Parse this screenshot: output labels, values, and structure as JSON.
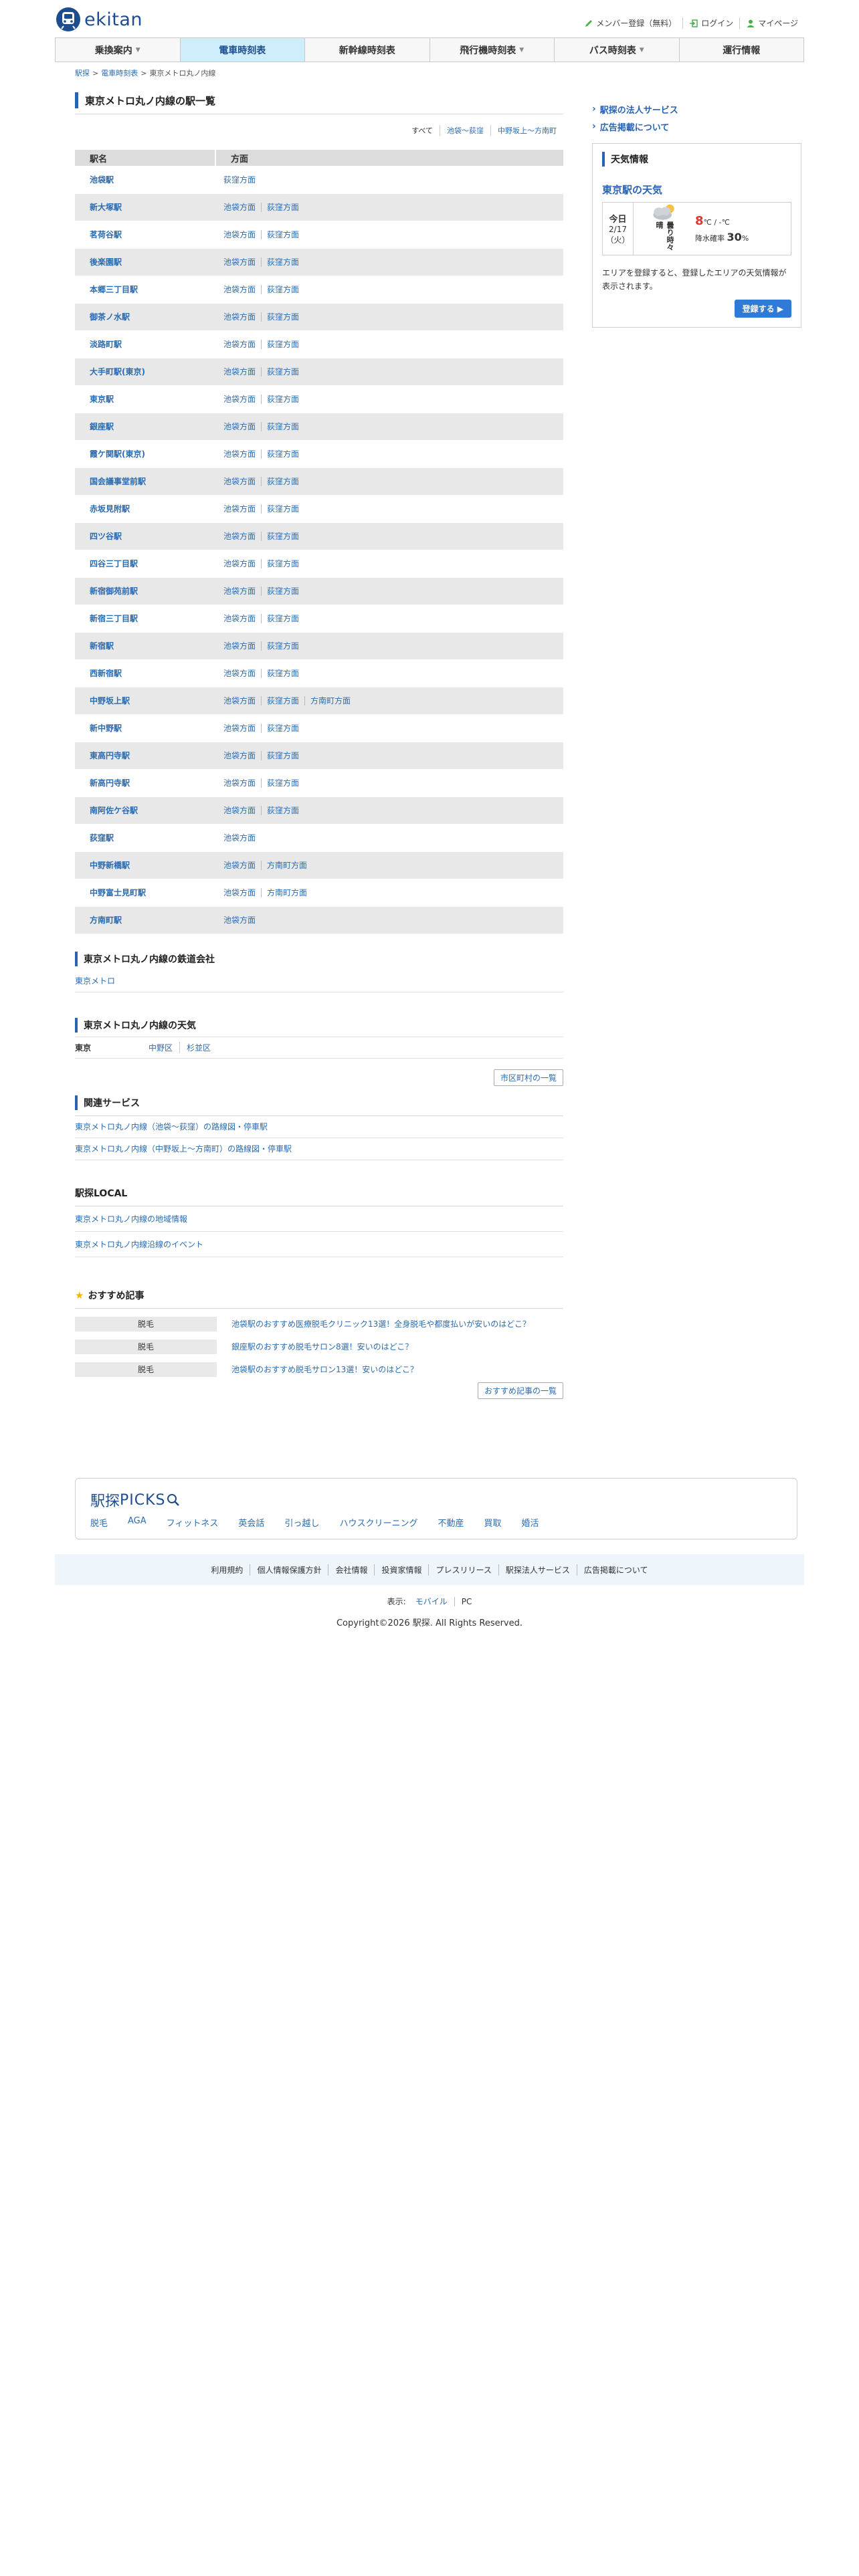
{
  "header": {
    "logo_text": "ekitan",
    "links": [
      {
        "label": "メンバー登録（無料）",
        "icon": "pencil-icon"
      },
      {
        "label": "ログイン",
        "icon": "login-icon"
      },
      {
        "label": "マイページ",
        "icon": "user-icon"
      }
    ]
  },
  "nav": [
    {
      "label": "乗換案内",
      "caret": true
    },
    {
      "label": "電車時刻表",
      "caret": false,
      "active": true
    },
    {
      "label": "新幹線時刻表",
      "caret": false
    },
    {
      "label": "飛行機時刻表",
      "caret": true
    },
    {
      "label": "バス時刻表",
      "caret": true
    },
    {
      "label": "運行情報",
      "caret": false
    }
  ],
  "breadcrumb": [
    "駅探",
    "電車時刻表",
    "東京メトロ丸ノ内線"
  ],
  "main": {
    "title": "東京メトロ丸ノ内線の駅一覧",
    "filters": [
      "すべて",
      "池袋〜荻窪",
      "中野坂上〜方南町"
    ],
    "table": {
      "headers": [
        "駅名",
        "方面"
      ],
      "rows": [
        {
          "name": "池袋駅",
          "dirs": [
            "荻窪方面"
          ]
        },
        {
          "name": "新大塚駅",
          "dirs": [
            "池袋方面",
            "荻窪方面"
          ]
        },
        {
          "name": "茗荷谷駅",
          "dirs": [
            "池袋方面",
            "荻窪方面"
          ]
        },
        {
          "name": "後楽園駅",
          "dirs": [
            "池袋方面",
            "荻窪方面"
          ]
        },
        {
          "name": "本郷三丁目駅",
          "dirs": [
            "池袋方面",
            "荻窪方面"
          ]
        },
        {
          "name": "御茶ノ水駅",
          "dirs": [
            "池袋方面",
            "荻窪方面"
          ]
        },
        {
          "name": "淡路町駅",
          "dirs": [
            "池袋方面",
            "荻窪方面"
          ]
        },
        {
          "name": "大手町駅(東京)",
          "dirs": [
            "池袋方面",
            "荻窪方面"
          ]
        },
        {
          "name": "東京駅",
          "dirs": [
            "池袋方面",
            "荻窪方面"
          ]
        },
        {
          "name": "銀座駅",
          "dirs": [
            "池袋方面",
            "荻窪方面"
          ]
        },
        {
          "name": "霞ケ関駅(東京)",
          "dirs": [
            "池袋方面",
            "荻窪方面"
          ]
        },
        {
          "name": "国会議事堂前駅",
          "dirs": [
            "池袋方面",
            "荻窪方面"
          ]
        },
        {
          "name": "赤坂見附駅",
          "dirs": [
            "池袋方面",
            "荻窪方面"
          ]
        },
        {
          "name": "四ツ谷駅",
          "dirs": [
            "池袋方面",
            "荻窪方面"
          ]
        },
        {
          "name": "四谷三丁目駅",
          "dirs": [
            "池袋方面",
            "荻窪方面"
          ]
        },
        {
          "name": "新宿御苑前駅",
          "dirs": [
            "池袋方面",
            "荻窪方面"
          ]
        },
        {
          "name": "新宿三丁目駅",
          "dirs": [
            "池袋方面",
            "荻窪方面"
          ]
        },
        {
          "name": "新宿駅",
          "dirs": [
            "池袋方面",
            "荻窪方面"
          ]
        },
        {
          "name": "西新宿駅",
          "dirs": [
            "池袋方面",
            "荻窪方面"
          ]
        },
        {
          "name": "中野坂上駅",
          "dirs": [
            "池袋方面",
            "荻窪方面",
            "方南町方面"
          ]
        },
        {
          "name": "新中野駅",
          "dirs": [
            "池袋方面",
            "荻窪方面"
          ]
        },
        {
          "name": "東高円寺駅",
          "dirs": [
            "池袋方面",
            "荻窪方面"
          ]
        },
        {
          "name": "新高円寺駅",
          "dirs": [
            "池袋方面",
            "荻窪方面"
          ]
        },
        {
          "name": "南阿佐ケ谷駅",
          "dirs": [
            "池袋方面",
            "荻窪方面"
          ]
        },
        {
          "name": "荻窪駅",
          "dirs": [
            "池袋方面"
          ]
        },
        {
          "name": "中野新橋駅",
          "dirs": [
            "池袋方面",
            "方南町方面"
          ]
        },
        {
          "name": "中野富士見町駅",
          "dirs": [
            "池袋方面",
            "方南町方面"
          ]
        },
        {
          "name": "方南町駅",
          "dirs": [
            "池袋方面"
          ]
        }
      ]
    },
    "company": {
      "title": "東京メトロ丸ノ内線の鉄道会社",
      "link": "東京メトロ"
    },
    "weather": {
      "title": "東京メトロ丸ノ内線の天気",
      "pref": "東京",
      "wards": [
        "中野区",
        "杉並区"
      ],
      "more": "市区町村の一覧"
    },
    "related": {
      "title": "関連サービス",
      "links": [
        "東京メトロ丸ノ内線（池袋〜荻窪）の路線図・停車駅",
        "東京メトロ丸ノ内線（中野坂上〜方南町）の路線図・停車駅"
      ]
    },
    "local": {
      "title": "駅探LOCAL",
      "links": [
        "東京メトロ丸ノ内線の地域情報",
        "東京メトロ丸ノ内線沿線のイベント"
      ]
    },
    "articles": {
      "title": "おすすめ記事",
      "items": [
        {
          "tag": "脱毛",
          "text": "池袋駅のおすすめ医療脱毛クリニック13選！全身脱毛や都度払いが安いのはどこ？"
        },
        {
          "tag": "脱毛",
          "text": "銀座駅のおすすめ脱毛サロン8選！安いのはどこ？"
        },
        {
          "tag": "脱毛",
          "text": "池袋駅のおすすめ脱毛サロン13選！安いのはどこ？"
        }
      ],
      "more": "おすすめ記事の一覧"
    }
  },
  "side": {
    "links": [
      "駅探の法人サービス",
      "広告掲載について"
    ],
    "weather": {
      "title": "天気情報",
      "station": "東京駅の天気",
      "day": "今日",
      "date": "2/17",
      "weekday": "（火）",
      "condition": "曇り時々晴",
      "hi": "8",
      "hi_unit": "℃",
      "lo": "-",
      "lo_unit": "℃",
      "rain_label": "降水確率",
      "rain": "30",
      "rain_unit": "%",
      "note": "エリアを登録すると、登録したエリアの天気情報が表示されます。",
      "button": "登録する ▶"
    }
  },
  "picks": {
    "title": "駅探",
    "title2": "PICKS",
    "items": [
      "脱毛",
      "AGA",
      "フィットネス",
      "英会話",
      "引っ越し",
      "ハウスクリーニング",
      "不動産",
      "買取",
      "婚活"
    ]
  },
  "footer": {
    "links": [
      "利用規約",
      "個人情報保護方針",
      "会社情報",
      "投資家情報",
      "プレスリリース",
      "駅探法人サービス",
      "広告掲載について"
    ],
    "display_label": "表示:",
    "display_options": [
      "モバイル",
      "PC"
    ],
    "copyright": "Copyright©2026 駅探. All Rights Reserved."
  },
  "colors": {
    "accent": "#2b63b3",
    "nav_active": "#cfeefb",
    "link": "#2b6cb0",
    "footer_bg": "#eef6fc",
    "temp_hi": "#e0362b"
  }
}
